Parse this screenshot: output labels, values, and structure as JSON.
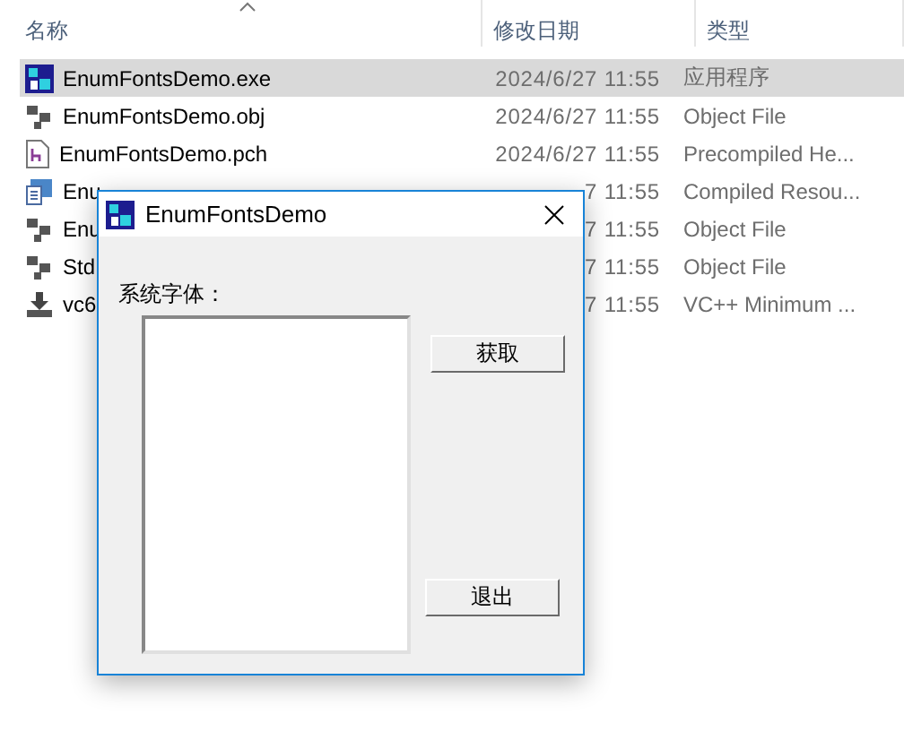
{
  "file_list": {
    "columns": [
      "名称",
      "修改日期",
      "类型"
    ],
    "rows": [
      {
        "kind": "exe",
        "name": "EnumFontsDemo.exe",
        "date": "2024/6/27 11:55",
        "type": "应用程序",
        "selected": true
      },
      {
        "kind": "obj",
        "name": "EnumFontsDemo.obj",
        "date": "2024/6/27 11:55",
        "type": "Object File",
        "selected": false
      },
      {
        "kind": "pch",
        "name": "EnumFontsDemo.pch",
        "date": "2024/6/27 11:55",
        "type": "Precompiled He...",
        "selected": false
      },
      {
        "kind": "res",
        "name": "Enu",
        "date": "7 11:55",
        "type": "Compiled Resou...",
        "selected": false
      },
      {
        "kind": "obj",
        "name": "Enu",
        "date": "7 11:55",
        "type": "Object File",
        "selected": false
      },
      {
        "kind": "obj",
        "name": "Std",
        "date": "7 11:55",
        "type": "Object File",
        "selected": false
      },
      {
        "kind": "ilk",
        "name": "vc6",
        "date": "7 11:55",
        "type": "VC++ Minimum ...",
        "selected": false
      }
    ]
  },
  "dialog": {
    "title": "EnumFontsDemo",
    "label": "系统字体：",
    "buttons": [
      "获取",
      "退出"
    ]
  }
}
